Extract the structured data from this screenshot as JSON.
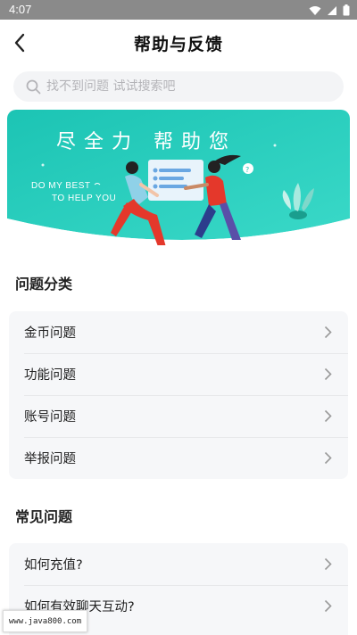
{
  "status_bar": {
    "time": "4:07"
  },
  "nav": {
    "title": "帮助与反馈"
  },
  "search": {
    "placeholder": "找不到问题 试试搜索吧"
  },
  "banner": {
    "title": "尽全力 帮助您",
    "subtitle_line1": "DO MY BEST",
    "subtitle_line2": "TO HELP YOU"
  },
  "categories": {
    "title": "问题分类",
    "items": [
      "金币问题",
      "功能问题",
      "账号问题",
      "举报问题"
    ]
  },
  "faq": {
    "title": "常见问题",
    "items": [
      "如何充值?",
      "如何有效聊天互动?"
    ]
  },
  "watermark": {
    "text": "www.java800.com"
  },
  "colors": {
    "banner_start": "#1fc6b4",
    "banner_end": "#38d8c6",
    "chevron": "#9a9a9a",
    "card_bg": "#f6f7f9"
  }
}
